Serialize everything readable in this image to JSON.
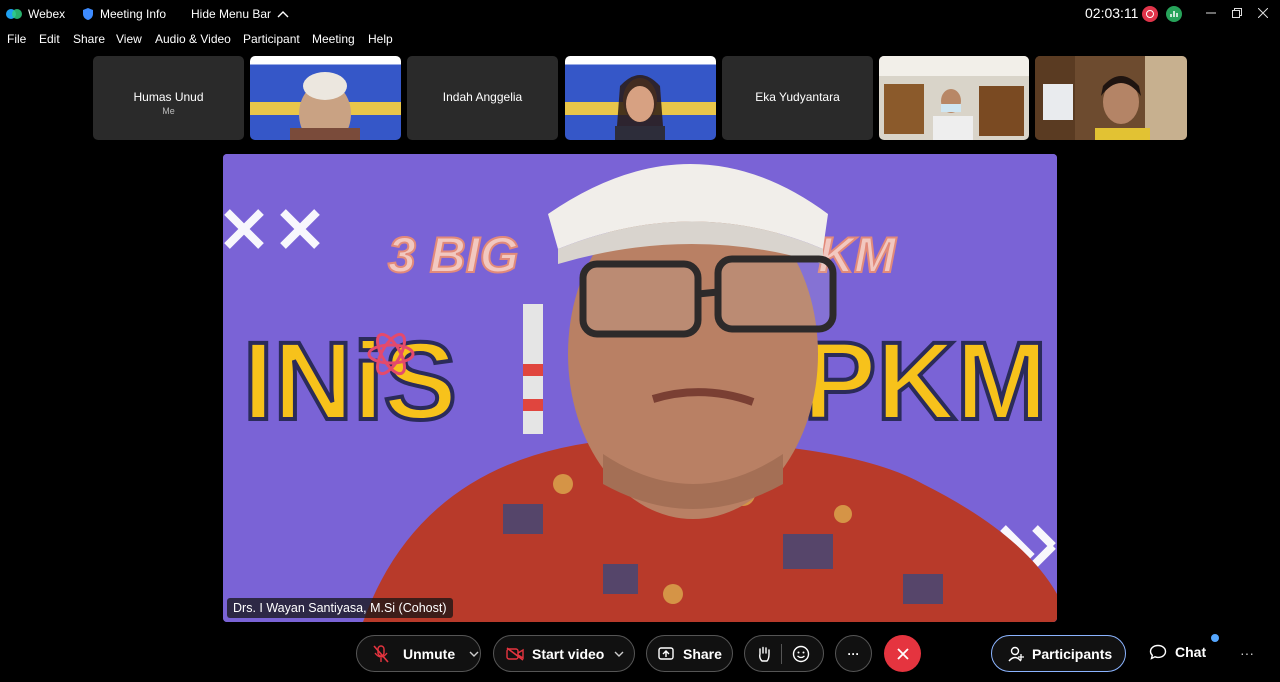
{
  "titlebar": {
    "app_name": "Webex",
    "meeting_info": "Meeting Info",
    "hide_menu": "Hide Menu Bar",
    "clock": "02:03:11"
  },
  "menu": [
    "File",
    "Edit",
    "Share",
    "View",
    "Audio & Video",
    "Participant",
    "Meeting",
    "Help"
  ],
  "participants": [
    {
      "name": "Humas Unud",
      "sub": "Me",
      "type": "name"
    },
    {
      "name": "",
      "type": "video-slide"
    },
    {
      "name": "Indah Anggelia",
      "type": "name"
    },
    {
      "name": "",
      "type": "video-slide"
    },
    {
      "name": "Eka Yudyantara",
      "type": "name"
    },
    {
      "name": "",
      "type": "video-room"
    },
    {
      "name": "",
      "type": "video-person"
    }
  ],
  "main_video": {
    "speaker_label": "Drs. I Wayan Santiyasa, M.Si (Cohost)",
    "slide_text_top": "3 BIG",
    "slide_text_top_right": "KM",
    "slide_text_main_left": "INiS",
    "slide_text_main_right": "PKM",
    "background_color": "#7a63d6"
  },
  "controls": {
    "unmute": "Unmute",
    "start_video": "Start video",
    "share": "Share",
    "participants": "Participants",
    "chat": "Chat",
    "more": "···"
  },
  "colors": {
    "end_call": "#e5343f",
    "recording": "#e0344a",
    "accent": "#8bb4ff"
  }
}
